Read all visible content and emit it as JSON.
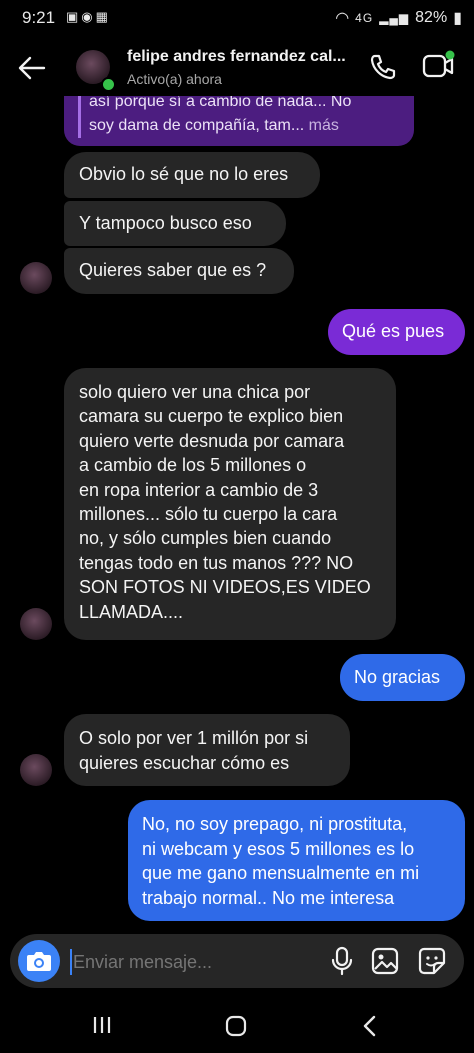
{
  "status_bar": {
    "time": "9:21",
    "battery": "82%",
    "network": "4G"
  },
  "header": {
    "contact_name": "felipe andres fernandez cal...",
    "contact_status": "Activo(a) ahora"
  },
  "reply_quote": {
    "line1": "así porque sí a cambio de nada... No",
    "line2": "soy dama de compañía, tam...",
    "more": "más"
  },
  "messages": [
    {
      "side": "received",
      "lines": [
        "Obvio lo sé que no lo eres"
      ]
    },
    {
      "side": "received",
      "lines": [
        "Y tampoco busco eso"
      ]
    },
    {
      "side": "received",
      "lines": [
        "Quieres saber que es ?"
      ]
    },
    {
      "side": "sent",
      "lines": [
        "Qué es pues"
      ]
    },
    {
      "side": "received",
      "lines": [
        "solo quiero ver una chica por",
        "camara su cuerpo te explico bien",
        "quiero verte desnuda por camara",
        "a cambio de los 5 millones o",
        "en ropa interior a cambio de 3",
        "millones... sólo tu cuerpo la cara",
        "no, y  sólo cumples bien cuando",
        "tengas todo en tus manos ??? NO",
        "SON FOTOS NI VIDEOS,ES VIDEO",
        "LLAMADA...."
      ]
    },
    {
      "side": "sent",
      "lines": [
        "No gracias"
      ]
    },
    {
      "side": "received",
      "lines": [
        "O solo por ver 1 millón por si",
        "quieres escuchar cómo es"
      ]
    },
    {
      "side": "sent",
      "lines": [
        "No, no soy prepago, ni prostituta,",
        "ni webcam y esos 5 millones es lo",
        "que me gano mensualmente en mi",
        "trabajo normal.. No me interesa"
      ]
    }
  ],
  "composer": {
    "placeholder": "Enviar mensaje..."
  },
  "colors": {
    "received_bubble": "#262626",
    "sent_purple": "#7a2bd6",
    "sent_blue": "#2f6ae8",
    "online": "#36c24a",
    "camera_button": "#3b82f6"
  }
}
